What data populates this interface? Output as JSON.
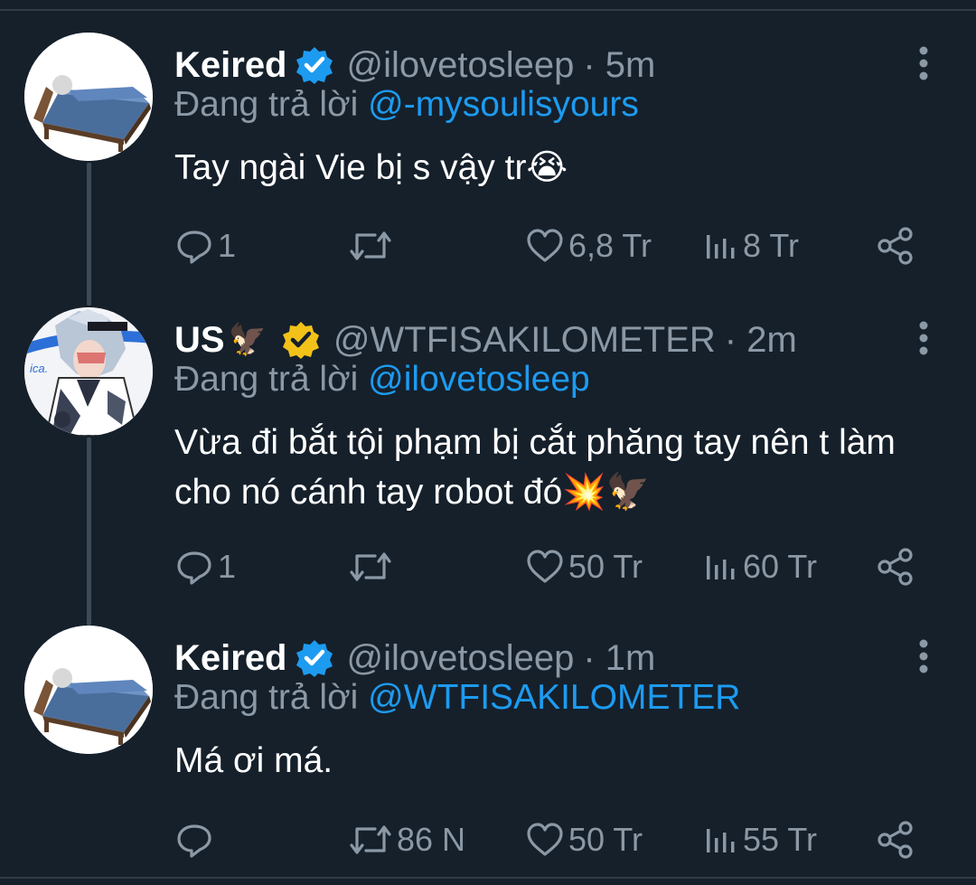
{
  "tweets": [
    {
      "display_name": "Keired",
      "name_emoji": "",
      "handle": "@ilovetosleep",
      "time": "· 5m",
      "badge_color": "#1d9bf0",
      "reply_prefix": "Đang trả lời",
      "reply_to": "@-mysoulisyours",
      "text": "Tay ngài Vie bị s vậy tr😭",
      "replies": "1",
      "retweets": "",
      "likes": "6,8 Tr",
      "views": "8 Tr",
      "avatar_icon": "sleeping-in-bed-avatar"
    },
    {
      "display_name": "US",
      "name_emoji": "🦅",
      "handle": "@WTFISAKILOMETER",
      "time": "· 2m",
      "badge_color": "#f2c219",
      "reply_prefix": "Đang trả lời",
      "reply_to": "@ilovetosleep",
      "text": "Vừa đi bắt tội phạm bị cắt phăng tay nên t làm cho nó cánh tay robot đó💥🦅",
      "replies": "1",
      "retweets": "",
      "likes": "50 Tr",
      "views": "60 Tr",
      "avatar_icon": "anime-character-avatar"
    },
    {
      "display_name": "Keired",
      "name_emoji": "",
      "handle": "@ilovetosleep",
      "time": "· 1m",
      "badge_color": "#1d9bf0",
      "reply_prefix": "Đang trả lời",
      "reply_to": "@WTFISAKILOMETER",
      "text": "Má ơi má.",
      "replies": "",
      "retweets": "86 N",
      "likes": "50 Tr",
      "views": "55 Tr",
      "avatar_icon": "sleeping-in-bed-avatar"
    }
  ],
  "colors": {
    "background": "#15202b",
    "secondary_text": "#8b98a5",
    "link": "#1d9bf0"
  }
}
